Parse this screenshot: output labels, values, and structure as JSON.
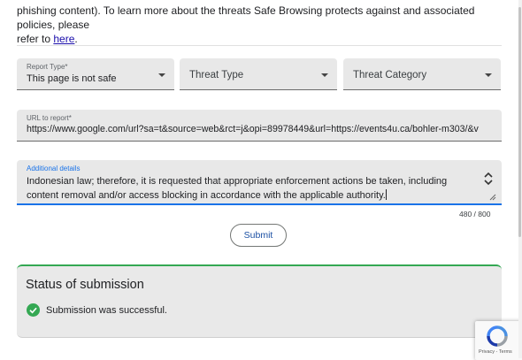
{
  "intro": {
    "cut_line": "phishing content). To learn more about the threats Safe Browsing protects against and associated policies, please",
    "line2_prefix": "refer to",
    "link": "here",
    "line2_suffix": "."
  },
  "form": {
    "report_type": {
      "label": "Report Type*",
      "value": "This page is not safe"
    },
    "threat_type": {
      "placeholder": "Threat Type"
    },
    "threat_category": {
      "placeholder": "Threat Category"
    },
    "url": {
      "label": "URL to report*",
      "value": "https://www.google.com/url?sa=t&source=web&rct=j&opi=89978449&url=https://events4u.ca/bohler-m303/&v"
    },
    "details": {
      "label": "Additional details",
      "value": "Indonesian law; therefore, it is requested that appropriate enforcement actions be taken, including content removal and/or access blocking in accordance with the applicable authority."
    },
    "counter": "480 / 800",
    "submit_label": "Submit"
  },
  "status": {
    "title": "Status of submission",
    "message": "Submission was successful.",
    "success_color": "#34a853"
  },
  "recaptcha": {
    "terms": "Privacy - Terms",
    "icon": "recaptcha-icon"
  }
}
